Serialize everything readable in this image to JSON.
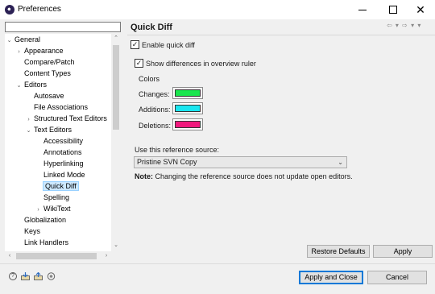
{
  "window": {
    "title": "Preferences",
    "controls": {
      "minimize": "minimize",
      "maximize": "maximize",
      "close": "✕"
    }
  },
  "sidebar": {
    "filter": {
      "value": "",
      "placeholder": ""
    },
    "tree": [
      {
        "label": "General",
        "indent": 0,
        "expander": "⌄"
      },
      {
        "label": "Appearance",
        "indent": 1,
        "expander": "›"
      },
      {
        "label": "Compare/Patch",
        "indent": 1,
        "expander": ""
      },
      {
        "label": "Content Types",
        "indent": 1,
        "expander": ""
      },
      {
        "label": "Editors",
        "indent": 1,
        "expander": "⌄"
      },
      {
        "label": "Autosave",
        "indent": 2,
        "expander": ""
      },
      {
        "label": "File Associations",
        "indent": 2,
        "expander": ""
      },
      {
        "label": "Structured Text Editors",
        "indent": 2,
        "expander": "›"
      },
      {
        "label": "Text Editors",
        "indent": 2,
        "expander": "⌄"
      },
      {
        "label": "Accessibility",
        "indent": 3,
        "expander": ""
      },
      {
        "label": "Annotations",
        "indent": 3,
        "expander": ""
      },
      {
        "label": "Hyperlinking",
        "indent": 3,
        "expander": ""
      },
      {
        "label": "Linked Mode",
        "indent": 3,
        "expander": ""
      },
      {
        "label": "Quick Diff",
        "indent": 3,
        "expander": "",
        "selected": true
      },
      {
        "label": "Spelling",
        "indent": 3,
        "expander": ""
      },
      {
        "label": "WikiText",
        "indent": 3,
        "expander": "›"
      },
      {
        "label": "Globalization",
        "indent": 1,
        "expander": ""
      },
      {
        "label": "Keys",
        "indent": 1,
        "expander": ""
      },
      {
        "label": "Link Handlers",
        "indent": 1,
        "expander": ""
      }
    ]
  },
  "page": {
    "title": "Quick Diff",
    "nav": "⇦ ▾ ⇨ ▾ ▾",
    "enable_quick_diff": {
      "label": "Enable quick diff",
      "checked": true
    },
    "show_in_ruler": {
      "label": "Show differences in overview ruler",
      "checked": true
    },
    "colors": {
      "title": "Colors",
      "items": [
        {
          "label": "Changes:",
          "color": "#19e64d"
        },
        {
          "label": "Additions:",
          "color": "#19e6f0"
        },
        {
          "label": "Deletions:",
          "color": "#f0197d"
        }
      ]
    },
    "reference_label": "Use this reference source:",
    "reference_value": "Pristine SVN Copy",
    "note_bold": "Note:",
    "note_text": " Changing the reference source does not update open editors.",
    "restore_defaults": "Restore Defaults",
    "apply": "Apply"
  },
  "footer": {
    "apply_and_close": "Apply and Close",
    "cancel": "Cancel",
    "icons": [
      "help-icon",
      "import-icon",
      "export-icon",
      "preferences-link-icon"
    ]
  }
}
